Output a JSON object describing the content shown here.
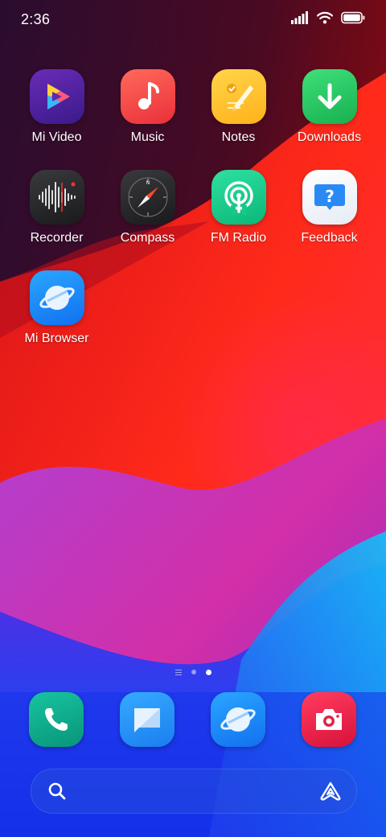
{
  "status_bar": {
    "time": "2:36",
    "icons": [
      "signal-icon",
      "wifi-icon",
      "battery-icon"
    ]
  },
  "apps": [
    {
      "label": "Mi Video",
      "icon": "mi-video-icon"
    },
    {
      "label": "Music",
      "icon": "music-icon"
    },
    {
      "label": "Notes",
      "icon": "notes-icon"
    },
    {
      "label": "Downloads",
      "icon": "downloads-icon"
    },
    {
      "label": "Recorder",
      "icon": "recorder-icon"
    },
    {
      "label": "Compass",
      "icon": "compass-icon"
    },
    {
      "label": "FM Radio",
      "icon": "fm-radio-icon"
    },
    {
      "label": "Feedback",
      "icon": "feedback-icon"
    },
    {
      "label": "Mi Browser",
      "icon": "mi-browser-icon"
    }
  ],
  "page_indicator": {
    "pages": 2,
    "current": 2
  },
  "dock": [
    {
      "icon": "phone-icon"
    },
    {
      "icon": "messages-icon"
    },
    {
      "icon": "browser-icon"
    },
    {
      "icon": "camera-icon"
    }
  ],
  "search": {
    "icons": [
      "search-icon",
      "assistant-icon"
    ]
  },
  "colors": {
    "wallpaper_dark": "#2a0a2c",
    "wallpaper_red": "#e0161a",
    "wallpaper_magenta": "#c02ab0",
    "wallpaper_blue": "#1a3ef0",
    "wallpaper_cyan": "#12b6f5"
  }
}
